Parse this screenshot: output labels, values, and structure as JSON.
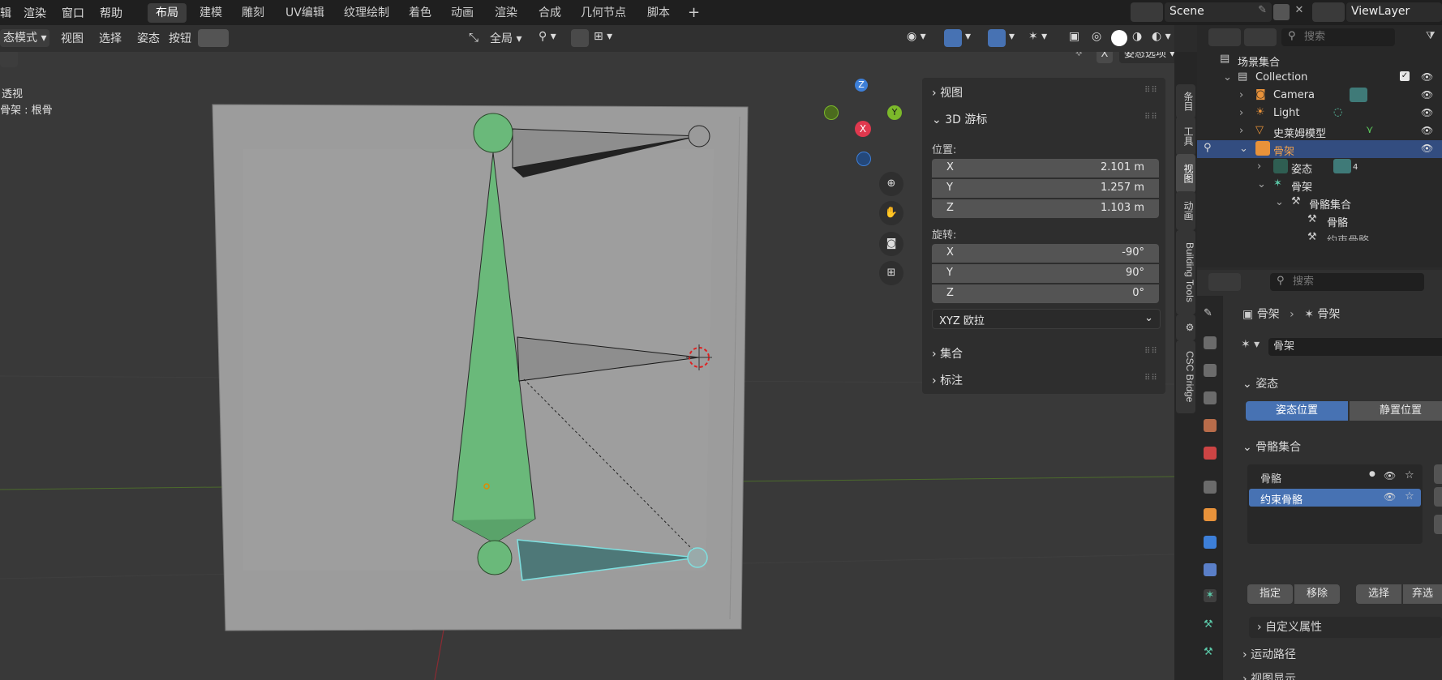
{
  "menu": {
    "items": [
      "辑",
      "渲染",
      "窗口",
      "帮助"
    ]
  },
  "workspaces": {
    "tabs": [
      "布局",
      "建模",
      "雕刻",
      "UV编辑",
      "纹理绘制",
      "着色",
      "动画",
      "渲染",
      "合成",
      "几何节点",
      "脚本"
    ],
    "active": "布局",
    "add": "+"
  },
  "scene": {
    "name": "Scene",
    "view_layer": "ViewLayer"
  },
  "header": {
    "mode": "态模式",
    "view": "视图",
    "select": "选择",
    "pose": "姿态",
    "buttons": "按钮",
    "transform": "全局"
  },
  "viewport": {
    "overlay_line1": "透视",
    "overlay_line2": "骨架 : 根骨",
    "pose_options": "姿态选项",
    "x_button": "X",
    "gizmo": {
      "z": "Z",
      "x": "X",
      "y": "Y"
    }
  },
  "npanel": {
    "view_title": "视图",
    "cursor_title": "3D 游标",
    "location_label": "位置:",
    "location": [
      {
        "k": "X",
        "v": "2.101 m"
      },
      {
        "k": "Y",
        "v": "1.257 m"
      },
      {
        "k": "Z",
        "v": "1.103 m"
      }
    ],
    "rotation_label": "旋转:",
    "rotation": [
      {
        "k": "X",
        "v": "-90°"
      },
      {
        "k": "Y",
        "v": "90°"
      },
      {
        "k": "Z",
        "v": "0°"
      }
    ],
    "rotation_mode": "XYZ 欧拉",
    "collection_title": "集合",
    "annotation_title": "标注"
  },
  "sidetabs": [
    "条目",
    "工具",
    "视图",
    "动画",
    "Building Tools",
    "CSC Bridge"
  ],
  "outliner": {
    "search_placeholder": "搜索",
    "rows": [
      {
        "label": "场景集合"
      },
      {
        "label": "Collection"
      },
      {
        "label": "Camera"
      },
      {
        "label": "Light"
      },
      {
        "label": "史莱姆模型"
      },
      {
        "label": "骨架"
      },
      {
        "label": "姿态"
      },
      {
        "label": "骨架"
      },
      {
        "label": "骨骼集合"
      },
      {
        "label": "骨骼"
      },
      {
        "label": "约束骨骼"
      }
    ],
    "pose_count": "4"
  },
  "properties": {
    "search_placeholder": "搜索",
    "breadcrumb_1": "骨架",
    "breadcrumb_2": "骨架",
    "data_name": "骨架",
    "pose_section": "姿态",
    "pose_position": "姿态位置",
    "rest_position": "静置位置",
    "bone_collections_section": "骨骼集合",
    "collections": [
      {
        "label": "骨骼"
      },
      {
        "label": "约束骨骼"
      }
    ],
    "assign": "指定",
    "remove": "移除",
    "select": "选择",
    "deselect": "弃选",
    "custom_props": "自定义属性",
    "motion_paths": "运动路径",
    "viewport_display": "视图显示"
  },
  "colors": {
    "accent": "#4772b3",
    "selection": "#334d80",
    "bone_green": "#6ab97a",
    "axis_x": "#e0384e",
    "axis_y": "#7cb92a",
    "axis_z": "#3d7fd8"
  }
}
